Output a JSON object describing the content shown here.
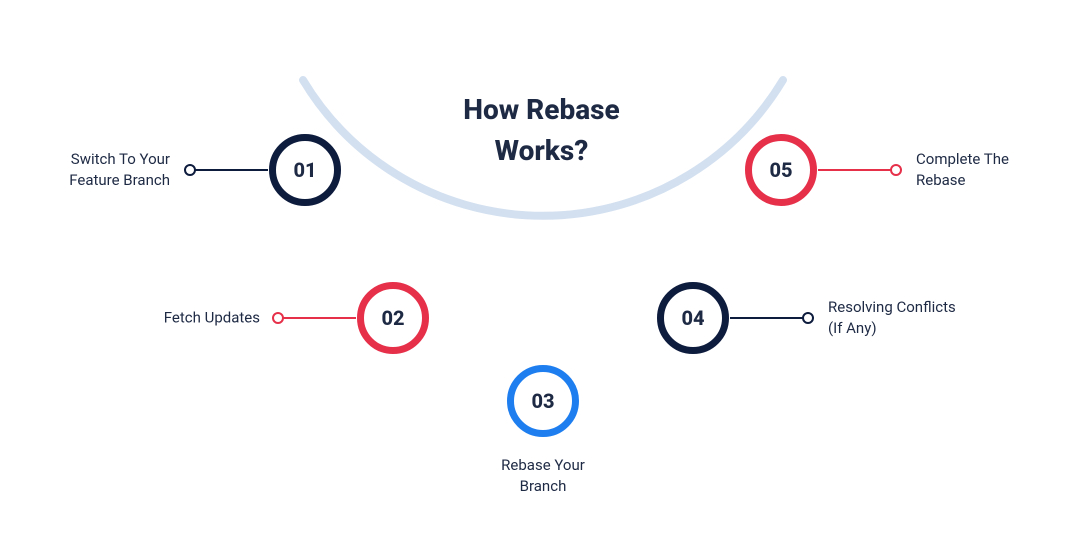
{
  "title_line1": "How Rebase",
  "title_line2": "Works?",
  "colors": {
    "navy": "#0d1b3d",
    "red": "#e6304a",
    "blue": "#1e7ef0",
    "arc": "#d3e0f0"
  },
  "steps": [
    {
      "num": "01",
      "label_l1": "Switch To Your",
      "label_l2": "Feature Branch",
      "color": "navy",
      "side": "left"
    },
    {
      "num": "02",
      "label_l1": "Fetch Updates",
      "label_l2": "",
      "color": "red",
      "side": "left"
    },
    {
      "num": "03",
      "label_l1": "Rebase Your",
      "label_l2": "Branch",
      "color": "blue",
      "side": "center"
    },
    {
      "num": "04",
      "label_l1": "Resolving Conflicts",
      "label_l2": "(If Any)",
      "color": "navy",
      "side": "right"
    },
    {
      "num": "05",
      "label_l1": "Complete The",
      "label_l2": "Rebase",
      "color": "red",
      "side": "right"
    }
  ]
}
